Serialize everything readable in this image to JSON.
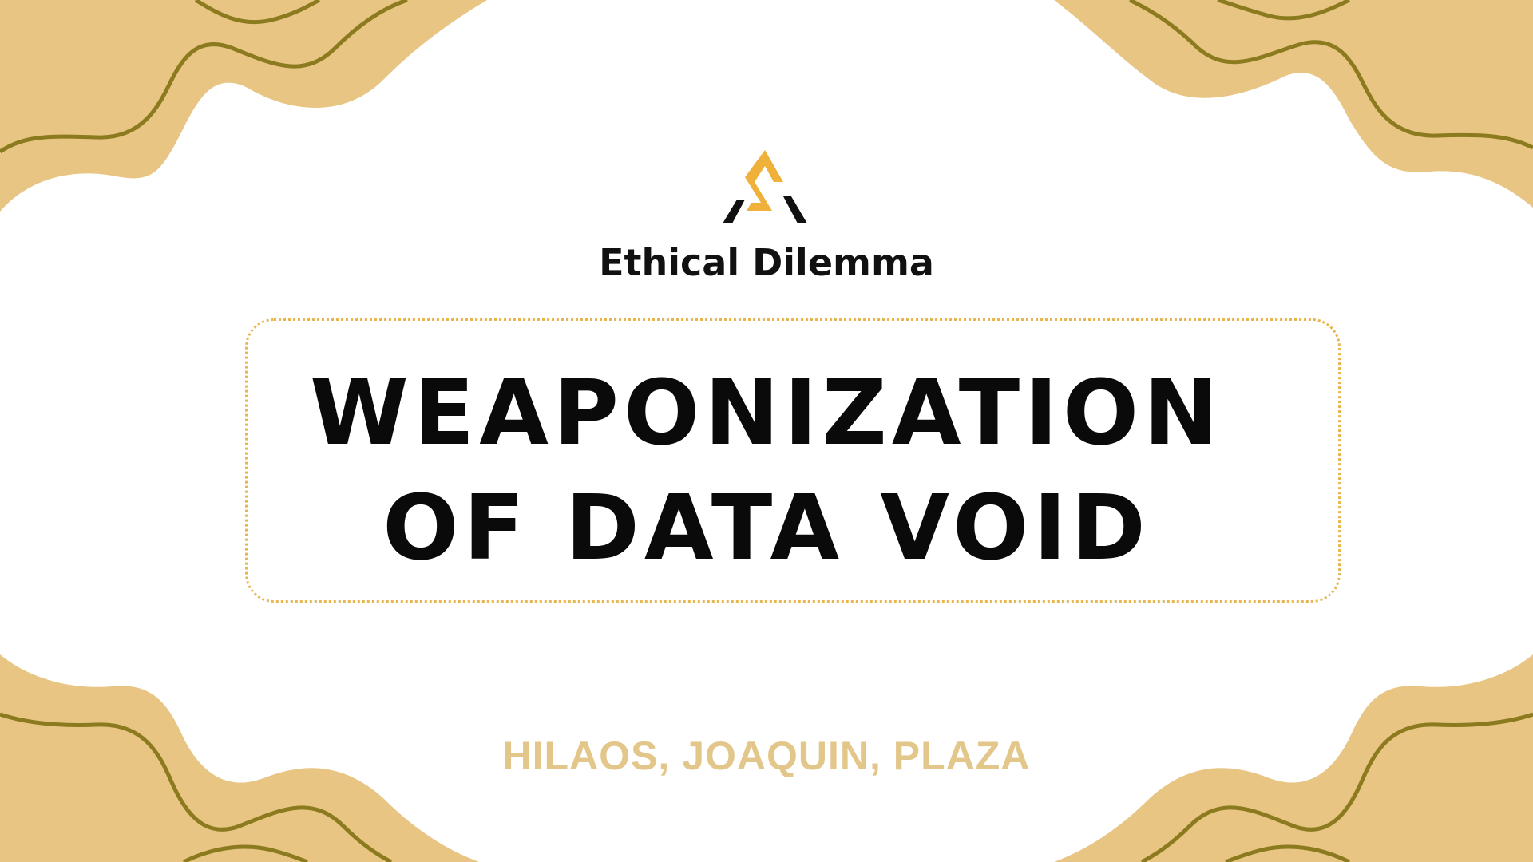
{
  "slide": {
    "brand_name": "Ethical Dilemma",
    "title_line_1": "WEAPONIZATION",
    "title_line_2": "OF DATA VOID",
    "authors": "HILAOS, JOAQUIN, PLAZA"
  },
  "icons": {
    "logo": "ethical-dilemma-logo-icon"
  },
  "colors": {
    "background": "#ffffff",
    "sand_fill": "#e8c582",
    "wave_stroke": "#8c7a1f",
    "logo_accent": "#f0b13b",
    "logo_dark": "#111111",
    "title_border": "#e8b64f",
    "authors_text": "#e3c68a",
    "title_text": "#0a0a0a"
  }
}
